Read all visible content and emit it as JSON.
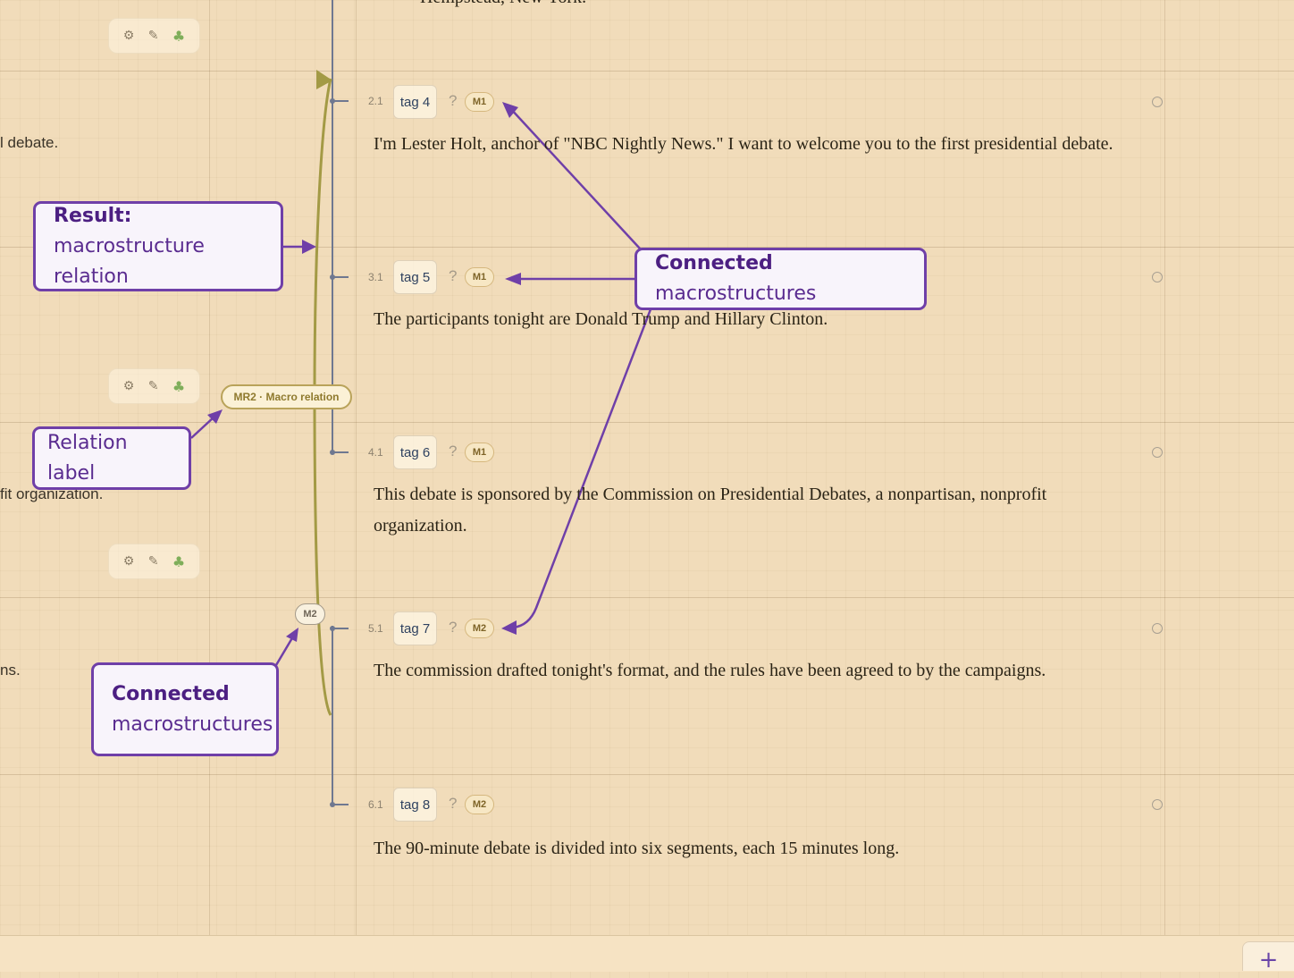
{
  "top_fragment": "Hempstead, New York.",
  "left_fragments": [
    "l debate.",
    "fit organization.",
    "ns."
  ],
  "tool_icons": [
    "gear-icon",
    "pencil-icon",
    "tree-icon"
  ],
  "tool_glyphs": {
    "gear": "⚙",
    "pencil": "✎",
    "tree": "♣"
  },
  "rows": [
    {
      "num": "2.1",
      "tag": "tag 4",
      "q": "?",
      "macro": "M1",
      "text": "I'm Lester Holt, anchor of \"NBC Nightly News.\" I want to welcome you to the first presidential debate."
    },
    {
      "num": "3.1",
      "tag": "tag 5",
      "q": "?",
      "macro": "M1",
      "text": "The participants tonight are Donald Trump and Hillary Clinton."
    },
    {
      "num": "4.1",
      "tag": "tag 6",
      "q": "?",
      "macro": "M1",
      "text": "This debate is sponsored by the Commission on Presidential Debates, a nonpartisan, nonprofit organization."
    },
    {
      "num": "5.1",
      "tag": "tag 7",
      "q": "?",
      "macro": "M2",
      "text": "The commission drafted tonight's format, and the rules have been agreed to by the campaigns."
    },
    {
      "num": "6.1",
      "tag": "tag 8",
      "q": "?",
      "macro": "M2",
      "text": "The 90-minute debate is divided into six segments, each 15 minutes long."
    }
  ],
  "relation_pill": "MR2 · Macro relation",
  "m2_pill": "M2",
  "callouts": {
    "result_bold": "Result:",
    "result_rest": " macrostructure relation",
    "connected_top_bold": "Connected",
    "connected_top_rest": " macrostructures",
    "relation_label": "Relation label",
    "connected_bottom_bold": "Connected",
    "connected_bottom_rest": " macrostructures"
  },
  "add_button": "+",
  "colors": {
    "accent": "#6f3fa8",
    "relation_line": "#a39a45",
    "tree_line": "#6f7890",
    "background": "#f1dcba"
  }
}
